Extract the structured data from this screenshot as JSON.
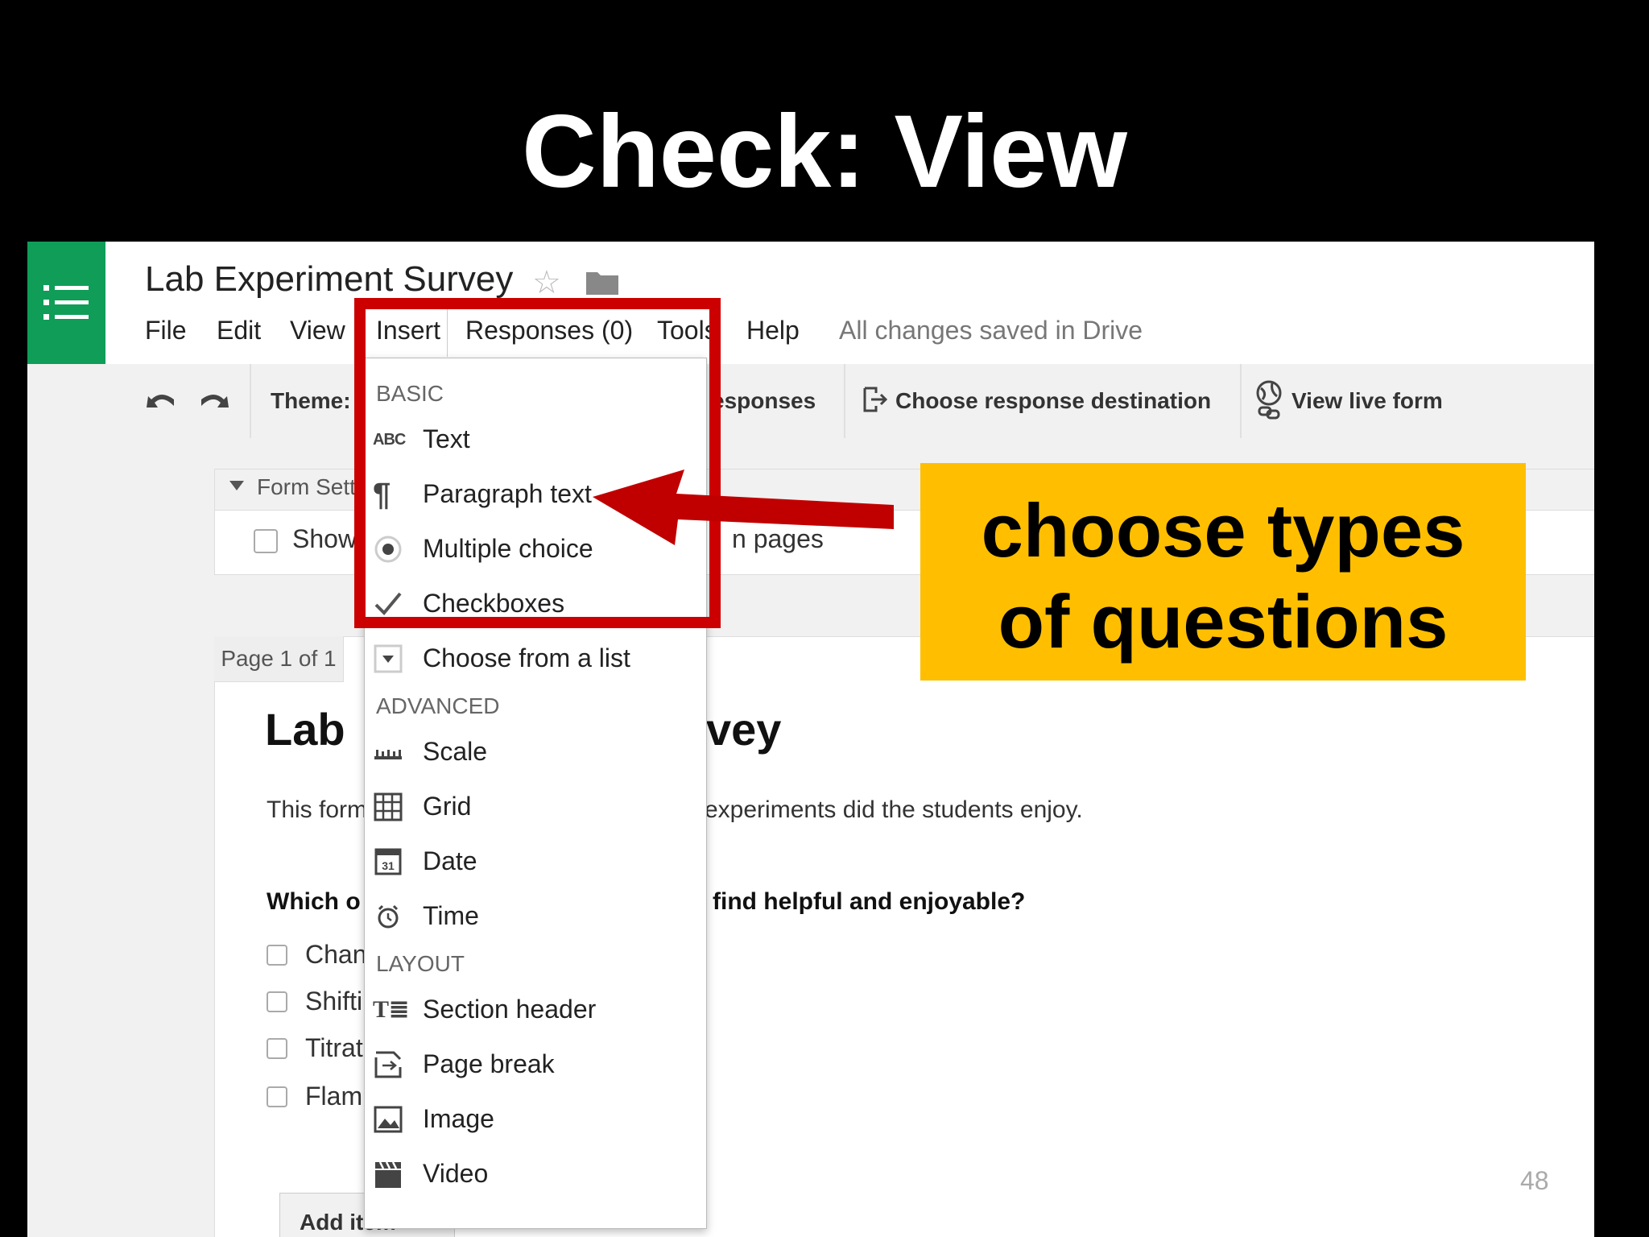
{
  "slide": {
    "title": "Check: View",
    "page_number": "48"
  },
  "app": {
    "doc_title": "Lab Experiment Survey",
    "menu": [
      "File",
      "Edit",
      "View",
      "Insert",
      "Responses (0)",
      "Tools",
      "Help"
    ],
    "save_status": "All changes saved in Drive",
    "toolbar": {
      "theme_label": "Theme:",
      "responses_partial": "esponses",
      "choose_destination": "Choose response destination",
      "view_live_form": "View live form"
    },
    "form_settings": {
      "header_partial": "Form Sett",
      "show_partial": "Show",
      "pages_partial": "n pages"
    },
    "form": {
      "page_tab": "Page 1 of 1",
      "title_left": "Lab",
      "title_right": "vey",
      "desc_left": "This form",
      "desc_right": "experiments did the students enjoy.",
      "question_left": "Which o",
      "question_right": "find helpful and enjoyable?",
      "options": [
        "Chan",
        "Shifti",
        "Titrat",
        "Flam"
      ],
      "add_item": "Add item"
    },
    "insert_menu": {
      "sections": {
        "basic": "BASIC",
        "advanced": "ADVANCED",
        "layout": "LAYOUT"
      },
      "basic": [
        {
          "label": "Text",
          "icon": "abc-icon"
        },
        {
          "label": "Paragraph text",
          "icon": "paragraph-icon"
        },
        {
          "label": "Multiple choice",
          "icon": "radio-icon"
        },
        {
          "label": "Checkboxes",
          "icon": "checkmark-icon"
        },
        {
          "label": "Choose from a list",
          "icon": "dropdown-icon"
        }
      ],
      "advanced": [
        {
          "label": "Scale",
          "icon": "scale-icon"
        },
        {
          "label": "Grid",
          "icon": "grid-icon"
        },
        {
          "label": "Date",
          "icon": "calendar-icon"
        },
        {
          "label": "Time",
          "icon": "clock-icon"
        }
      ],
      "layout": [
        {
          "label": "Section header",
          "icon": "section-header-icon"
        },
        {
          "label": "Page break",
          "icon": "page-break-icon"
        },
        {
          "label": "Image",
          "icon": "image-icon"
        },
        {
          "label": "Video",
          "icon": "video-icon"
        }
      ]
    }
  },
  "annotation": {
    "callout_line1": "choose types",
    "callout_line2": "of questions",
    "highlight_color": "#cc0000",
    "callout_color": "#ffbf00"
  }
}
